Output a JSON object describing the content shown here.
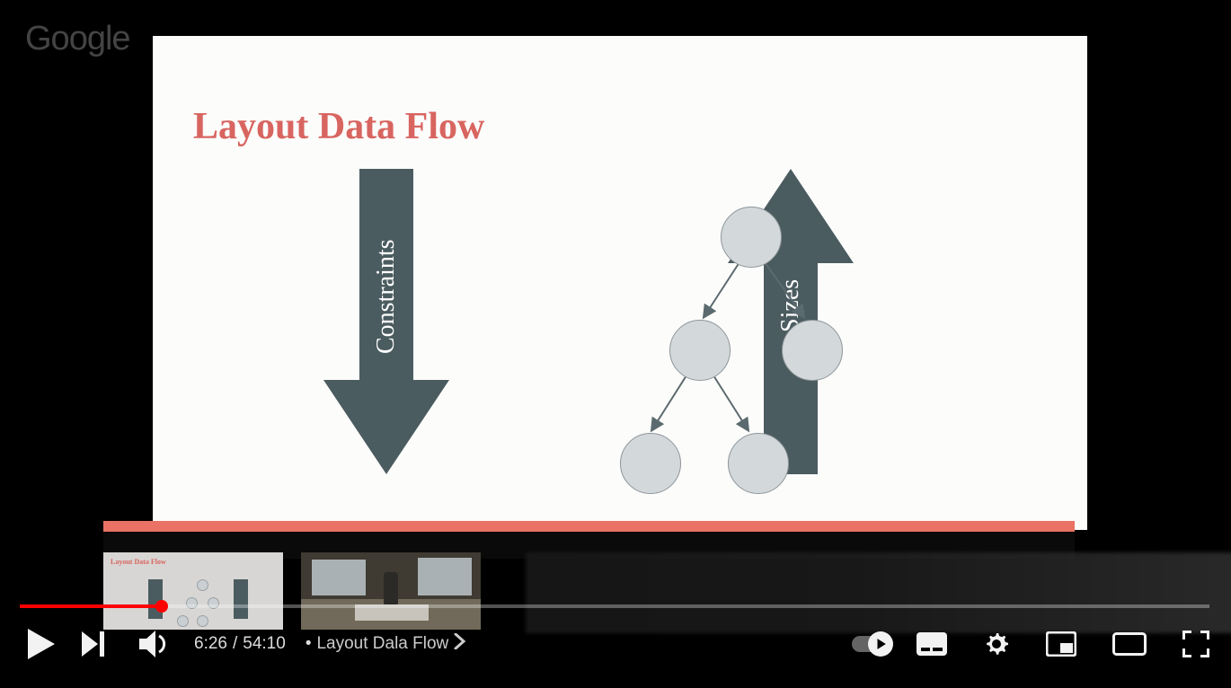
{
  "watermark": "Google",
  "slide": {
    "title": "Layout Data Flow",
    "left_arrow_label": "Constraints",
    "right_arrow_label": "Sizes"
  },
  "player": {
    "current_time": "6:26",
    "duration": "54:10",
    "chapter_separator": "•",
    "chapter_label": "Layout Dala Flow",
    "progress_pct": 11.9
  },
  "thumbs": {
    "mini_title": "Layout Data Flow"
  },
  "icons": {
    "play": "play-icon",
    "next": "next-icon",
    "volume": "volume-icon",
    "chevron": "chevron-right-icon",
    "autoplay": "autoplay-toggle",
    "captions": "captions-icon",
    "settings": "gear-icon",
    "miniplayer": "miniplayer-icon",
    "theater": "theater-icon",
    "fullscreen": "fullscreen-icon"
  }
}
